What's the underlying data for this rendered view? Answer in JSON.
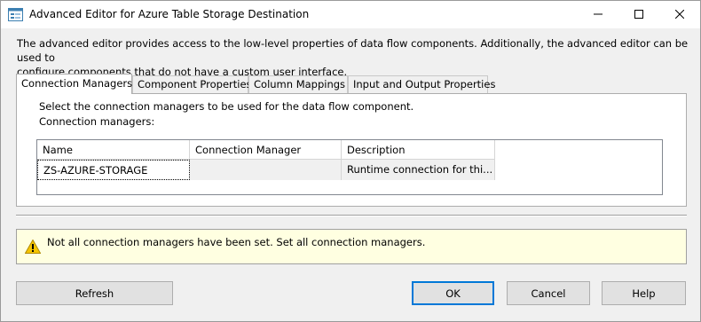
{
  "window": {
    "title": "Advanced Editor for Azure Table Storage Destination",
    "minimize_icon": "minimize-icon",
    "maximize_icon": "maximize-icon",
    "close_icon": "close-icon"
  },
  "description_line1": "The advanced editor provides access to the low-level properties of data flow components. Additionally, the advanced editor can be used to",
  "description_line2": "configure components that do not have a custom user interface.",
  "tabs": [
    {
      "label": "Connection Managers",
      "active": true
    },
    {
      "label": "Component Properties",
      "active": false
    },
    {
      "label": "Column Mappings",
      "active": false
    },
    {
      "label": "Input and Output Properties",
      "active": false
    }
  ],
  "panel": {
    "instruction": "Select the connection managers to be used for the data flow component.",
    "grid_label": "Connection managers:",
    "columns": [
      "Name",
      "Connection Manager",
      "Description"
    ],
    "rows": [
      {
        "name": "ZS-AZURE-STORAGE",
        "connection_manager": "",
        "description": "Runtime connection for thi..."
      }
    ]
  },
  "warning": {
    "icon": "warning-icon",
    "text": "Not all connection managers have been set. Set all connection managers."
  },
  "buttons": {
    "refresh": "Refresh",
    "ok": "OK",
    "cancel": "Cancel",
    "help": "Help"
  },
  "colors": {
    "accent": "#0078d7",
    "warning_bg": "#ffffe1"
  }
}
